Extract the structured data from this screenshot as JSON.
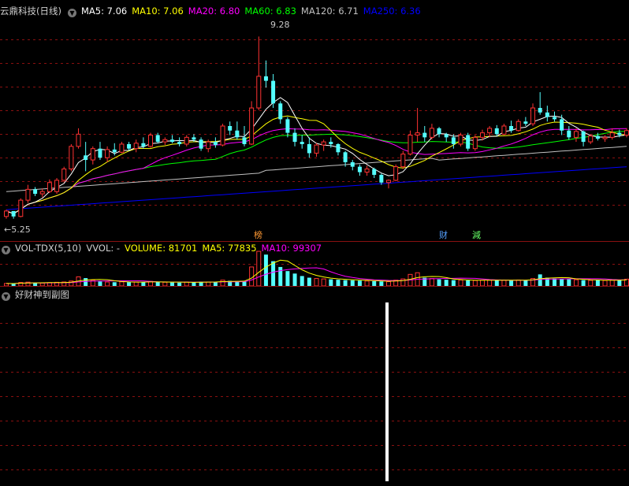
{
  "colors": {
    "up": "#ff3232",
    "down": "#54ffff",
    "ma5": "#ffffff",
    "ma10": "#ffff00",
    "ma20": "#ff00ff",
    "ma60": "#00ff00",
    "ma120": "#c0c0c0",
    "ma250": "#0000ff",
    "grid": "#8a1010"
  },
  "main_panel": {
    "stock_name": "云鼎科技",
    "period": "(日线)",
    "collapse_icon": "chevron-down-icon",
    "ma_labels": [
      {
        "name": "MA5",
        "value": "7.06",
        "color": "#ffffff"
      },
      {
        "name": "MA10",
        "value": "7.06",
        "color": "#ffff00"
      },
      {
        "name": "MA20",
        "value": "6.80",
        "color": "#ff00ff"
      },
      {
        "name": "MA60",
        "value": "6.83",
        "color": "#00ff00"
      },
      {
        "name": "MA120",
        "value": "6.71",
        "color": "#c0c0c0"
      },
      {
        "name": "MA250",
        "value": "6.36",
        "color": "#0000ff"
      }
    ],
    "high_label": "9.28",
    "low_label": "5.25",
    "markers": [
      {
        "text": "榜",
        "color": "#ff9933"
      },
      {
        "text": "财",
        "color": "#54a0ff"
      },
      {
        "text": "減",
        "color": "#66ff66"
      }
    ]
  },
  "vol_panel": {
    "indicator": "VOL-TDX(5,10)",
    "vvol": "VVOL: -",
    "volume_label": "VOLUME: 81701",
    "ma5_label": "MA5: 77835",
    "ma10_label": "MA10: 99307"
  },
  "sub_panel": {
    "title": "好财神到副图"
  },
  "chart_data": {
    "type": "candlestick",
    "ohlc": [
      [
        5.3,
        5.45,
        5.25,
        5.42
      ],
      [
        5.42,
        5.4,
        5.25,
        5.3
      ],
      [
        5.3,
        5.7,
        5.28,
        5.66
      ],
      [
        5.66,
        6.0,
        5.6,
        5.9
      ],
      [
        5.9,
        5.95,
        5.75,
        5.8
      ],
      [
        5.8,
        5.92,
        5.72,
        5.85
      ],
      [
        5.85,
        6.12,
        5.82,
        6.05
      ],
      [
        5.85,
        6.15,
        5.8,
        6.1
      ],
      [
        6.1,
        6.4,
        6.05,
        6.35
      ],
      [
        6.35,
        6.9,
        6.3,
        6.85
      ],
      [
        6.85,
        7.25,
        6.8,
        7.12
      ],
      [
        6.65,
        6.95,
        6.3,
        6.55
      ],
      [
        6.55,
        6.85,
        6.45,
        6.8
      ],
      [
        6.8,
        6.95,
        6.55,
        6.6
      ],
      [
        6.6,
        6.85,
        6.5,
        6.78
      ],
      [
        6.78,
        6.92,
        6.65,
        6.72
      ],
      [
        6.72,
        6.95,
        6.7,
        6.9
      ],
      [
        6.9,
        6.95,
        6.75,
        6.8
      ],
      [
        6.8,
        7.0,
        6.72,
        6.92
      ],
      [
        6.92,
        7.05,
        6.8,
        6.85
      ],
      [
        6.85,
        7.15,
        6.82,
        7.1
      ],
      [
        7.1,
        7.15,
        6.92,
        6.95
      ],
      [
        6.95,
        7.05,
        6.88,
        7.0
      ],
      [
        7.0,
        7.1,
        6.92,
        6.95
      ],
      [
        6.95,
        7.05,
        6.85,
        6.9
      ],
      [
        6.9,
        7.1,
        6.85,
        7.05
      ],
      [
        7.05,
        7.12,
        6.95,
        7.0
      ],
      [
        7.0,
        7.05,
        6.75,
        6.8
      ],
      [
        6.8,
        7.0,
        6.72,
        6.95
      ],
      [
        6.95,
        7.05,
        6.82,
        6.88
      ],
      [
        6.88,
        7.35,
        6.85,
        7.3
      ],
      [
        7.3,
        7.4,
        7.1,
        7.2
      ],
      [
        7.2,
        7.4,
        7.0,
        7.05
      ],
      [
        7.05,
        7.3,
        6.85,
        6.9
      ],
      [
        6.9,
        7.85,
        6.88,
        7.7
      ],
      [
        7.7,
        9.28,
        7.65,
        8.4
      ],
      [
        8.4,
        8.75,
        8.15,
        8.3
      ],
      [
        8.3,
        8.45,
        7.7,
        7.8
      ],
      [
        7.8,
        7.85,
        7.35,
        7.45
      ],
      [
        7.45,
        7.5,
        7.05,
        7.15
      ],
      [
        7.15,
        7.25,
        6.85,
        6.95
      ],
      [
        6.95,
        7.1,
        6.8,
        6.9
      ],
      [
        6.9,
        7.05,
        6.6,
        6.7
      ],
      [
        6.7,
        6.92,
        6.62,
        6.88
      ],
      [
        6.88,
        7.0,
        6.75,
        6.95
      ],
      [
        6.95,
        7.05,
        6.82,
        6.9
      ],
      [
        6.9,
        6.92,
        6.65,
        6.72
      ],
      [
        6.72,
        6.75,
        6.4,
        6.5
      ],
      [
        6.5,
        6.55,
        6.32,
        6.4
      ],
      [
        6.4,
        6.45,
        6.2,
        6.28
      ],
      [
        6.28,
        6.42,
        6.2,
        6.35
      ],
      [
        6.35,
        6.38,
        6.15,
        6.22
      ],
      [
        6.22,
        6.25,
        6.0,
        6.05
      ],
      [
        6.05,
        6.12,
        5.92,
        6.1
      ],
      [
        6.1,
        6.45,
        6.08,
        6.4
      ],
      [
        6.4,
        6.75,
        6.35,
        6.68
      ],
      [
        6.68,
        7.2,
        6.65,
        7.1
      ],
      [
        7.1,
        7.7,
        6.95,
        7.15
      ],
      [
        7.15,
        7.3,
        6.95,
        7.05
      ],
      [
        7.05,
        7.35,
        7.0,
        7.25
      ],
      [
        7.25,
        7.28,
        7.05,
        7.12
      ],
      [
        7.12,
        7.15,
        6.95,
        7.05
      ],
      [
        7.05,
        7.12,
        6.8,
        6.9
      ],
      [
        6.9,
        7.15,
        6.85,
        7.1
      ],
      [
        7.1,
        7.15,
        6.75,
        6.8
      ],
      [
        6.8,
        7.1,
        6.75,
        7.05
      ],
      [
        7.05,
        7.22,
        6.98,
        7.15
      ],
      [
        7.15,
        7.3,
        7.05,
        7.25
      ],
      [
        7.25,
        7.32,
        7.08,
        7.12
      ],
      [
        7.12,
        7.35,
        7.1,
        7.3
      ],
      [
        7.3,
        7.42,
        7.15,
        7.2
      ],
      [
        7.2,
        7.45,
        7.18,
        7.4
      ],
      [
        7.4,
        7.5,
        7.3,
        7.35
      ],
      [
        7.35,
        7.8,
        7.3,
        7.7
      ],
      [
        7.7,
        8.05,
        7.55,
        7.6
      ],
      [
        7.6,
        7.75,
        7.4,
        7.5
      ],
      [
        7.5,
        7.62,
        7.4,
        7.45
      ],
      [
        7.45,
        7.55,
        7.1,
        7.2
      ],
      [
        7.2,
        7.3,
        7.0,
        7.05
      ],
      [
        7.05,
        7.25,
        6.95,
        7.18
      ],
      [
        7.18,
        7.2,
        6.85,
        6.95
      ],
      [
        6.95,
        7.12,
        6.9,
        7.08
      ],
      [
        7.08,
        7.15,
        6.98,
        7.02
      ],
      [
        7.02,
        7.1,
        6.95,
        7.05
      ],
      [
        7.05,
        7.25,
        7.0,
        7.15
      ],
      [
        7.15,
        7.22,
        7.05,
        7.1
      ],
      [
        7.1,
        7.25,
        7.05,
        7.2
      ]
    ],
    "volume_max": 430000,
    "volumes": [
      30000,
      28000,
      42000,
      46000,
      38000,
      35000,
      40000,
      44000,
      48000,
      60000,
      110000,
      95000,
      70000,
      55000,
      48000,
      45000,
      50000,
      46000,
      47000,
      44000,
      55000,
      50000,
      45000,
      42000,
      40000,
      48000,
      46000,
      52000,
      48000,
      45000,
      70000,
      62000,
      58000,
      55000,
      230000,
      420000,
      380000,
      300000,
      230000,
      180000,
      150000,
      120000,
      100000,
      90000,
      85000,
      80000,
      75000,
      70000,
      68000,
      64000,
      60000,
      58000,
      55000,
      52000,
      70000,
      85000,
      140000,
      160000,
      100000,
      90000,
      80000,
      75000,
      70000,
      72000,
      68000,
      66000,
      70000,
      72000,
      68000,
      70000,
      65000,
      72000,
      70000,
      90000,
      140000,
      100000,
      90000,
      85000,
      80000,
      75000,
      70000,
      68000,
      72000,
      66000,
      70000,
      72000,
      82000
    ],
    "ylim": [
      5.0,
      9.6
    ]
  }
}
